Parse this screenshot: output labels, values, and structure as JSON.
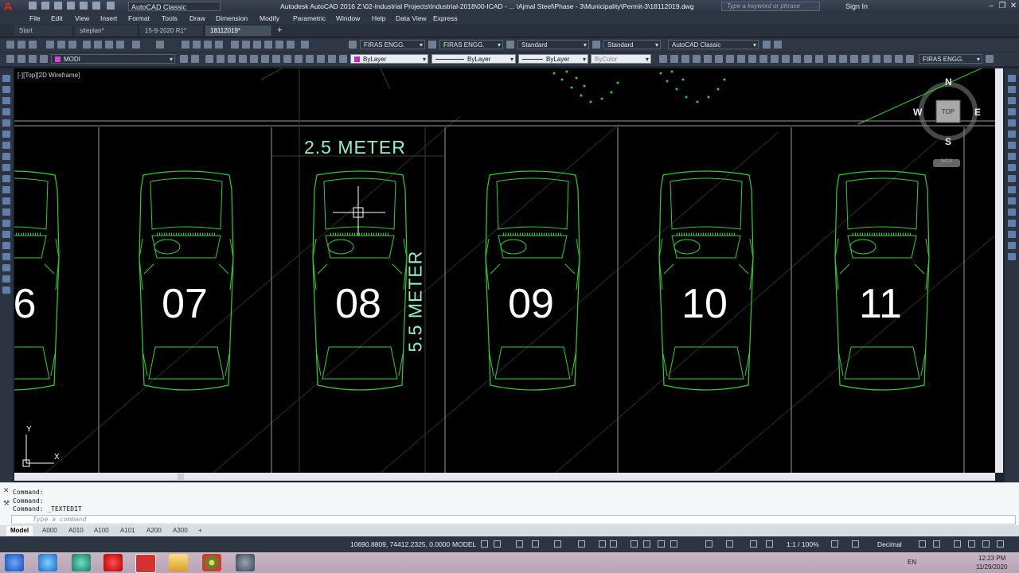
{
  "titlebar": {
    "workspace": "AutoCAD Classic",
    "title": "Autodesk AutoCAD 2016    Z:\\02-Industrial Projects\\Industrial-2018\\00-ICAD - ... \\Ajmal Steel\\Phase - 3\\Municipality\\Permit-3\\18112019.dwg",
    "search_placeholder": "Type a keyword or phrase",
    "sign_in": "Sign In"
  },
  "menus": [
    "File",
    "Edit",
    "View",
    "Insert",
    "Format",
    "Tools",
    "Draw",
    "Dimension",
    "Modify",
    "Parametric",
    "Window",
    "Help",
    "Data View",
    "Express"
  ],
  "doc_tabs": [
    "Start",
    "siteplan*",
    "15-9-2020 R1*",
    "18112019*"
  ],
  "toolbar1": {
    "text_style": "FIRAS ENGG.",
    "dim_style": "FIRAS ENGG.",
    "table_style": "Standard",
    "mleader_style": "Standard",
    "workspace": "AutoCAD Classic"
  },
  "toolbar2": {
    "layer": "MODI",
    "color": "ByLayer",
    "linetype": "ByLayer",
    "lineweight": "ByLayer",
    "plotstyle": "ByColor",
    "right_style": "FIRAS ENGG."
  },
  "view_label": "[-][Top][2D Wireframe]",
  "drawing": {
    "dim_horizontal": "2.5 METER",
    "dim_vertical": "5.5 METER",
    "spaces": [
      "6",
      "07",
      "08",
      "09",
      "10",
      "11"
    ]
  },
  "viewcube": {
    "n": "N",
    "s": "S",
    "e": "E",
    "w": "W",
    "top": "TOP",
    "ucs": "WCS"
  },
  "ucs": {
    "x": "X",
    "y": "Y"
  },
  "command_history": [
    "Command:",
    "Command:",
    "Command:  _TEXTEDIT"
  ],
  "command_placeholder": "Type a command",
  "layout_tabs": [
    "Model",
    "A000",
    "A010",
    "A100",
    "A101",
    "A200",
    "A300"
  ],
  "status": {
    "coords": "10690.8809, 74412.2325, 0.0000",
    "mode": "MODEL",
    "scale": "1:1 / 100%",
    "units": "Decimal"
  },
  "tray": {
    "lang": "EN",
    "time": "12:23 PM",
    "date": "11/29/2020"
  },
  "colors": {
    "car_line": "#2fd02f",
    "dim_text": "#8ff0c8",
    "parking_line": "#9a9a9a"
  }
}
